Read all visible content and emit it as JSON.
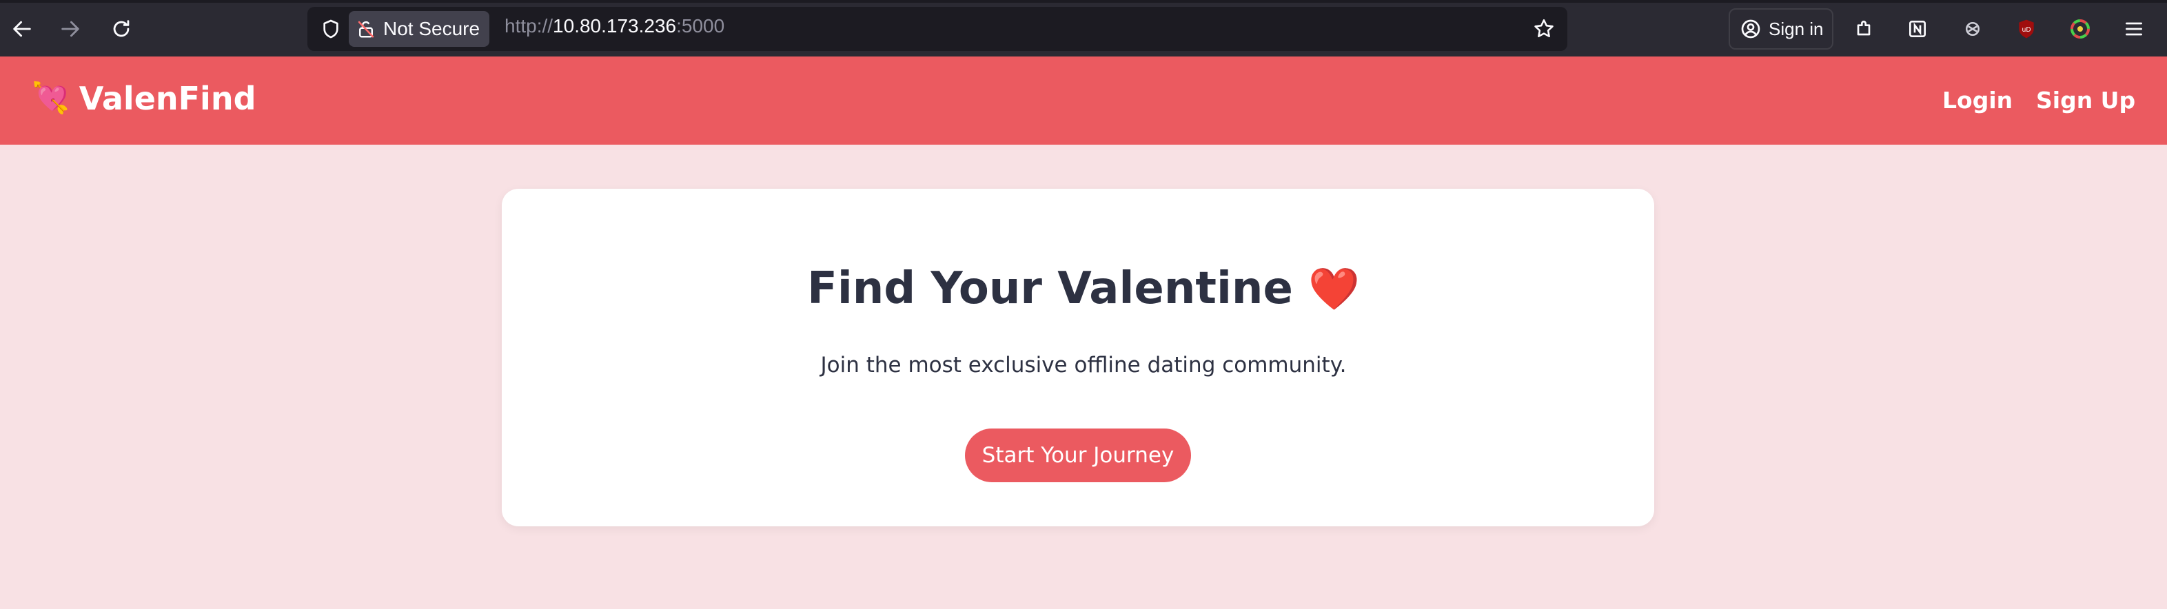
{
  "browser": {
    "security_label": "Not Secure",
    "url_scheme": "http://",
    "url_host": "10.80.173.236",
    "url_port": ":5000",
    "signin_label": "Sign in"
  },
  "site": {
    "brand_icon": "💘",
    "brand_name": "ValenFind",
    "nav": {
      "login": "Login",
      "signup": "Sign Up"
    }
  },
  "hero": {
    "title": "Find Your Valentine",
    "title_emoji": "❤️",
    "subtitle": "Join the most exclusive offline dating community.",
    "cta_label": "Start Your Journey"
  },
  "colors": {
    "brand": "#eb5a60",
    "page_bg": "#f8e1e4",
    "text_dark": "#2d3142",
    "chrome_bg": "#2b2a33"
  }
}
